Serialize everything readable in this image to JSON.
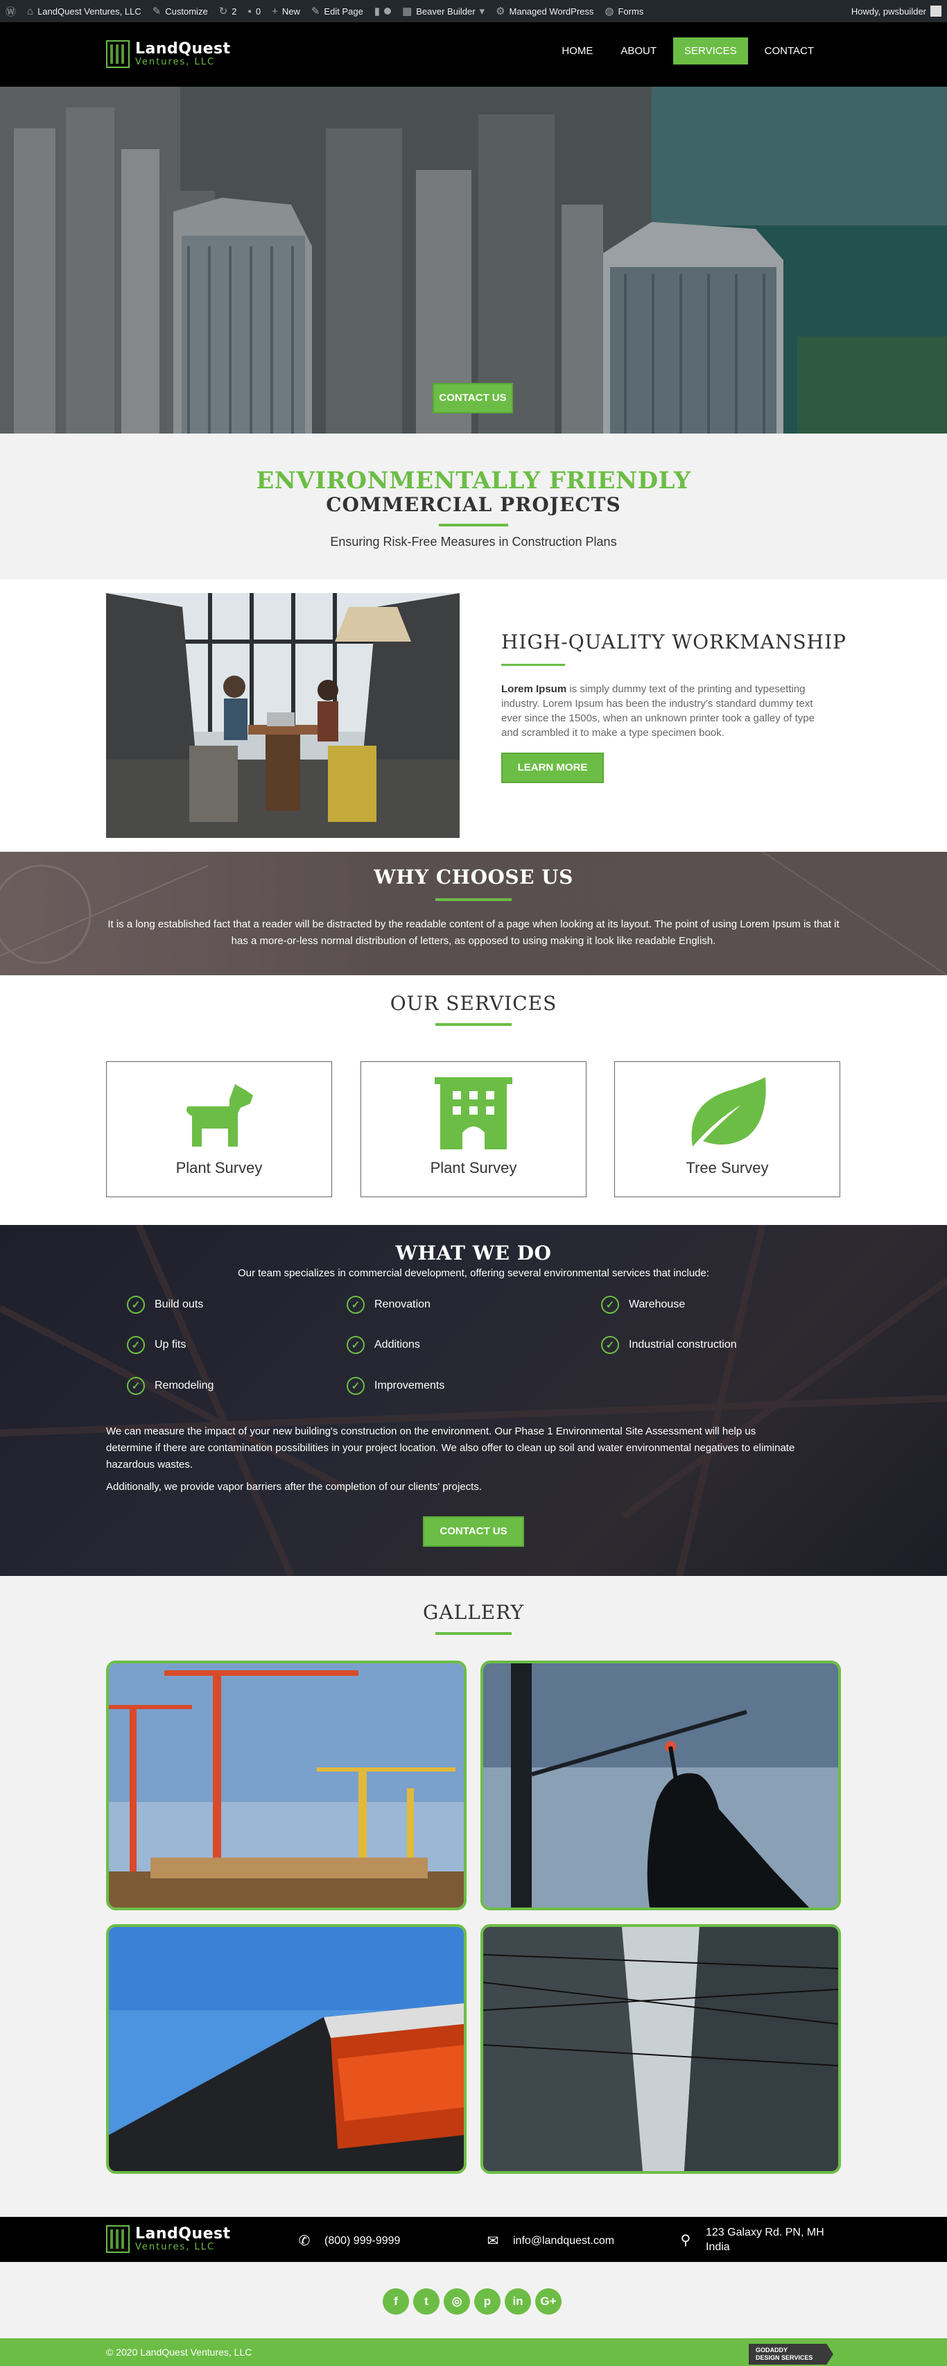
{
  "adminbar": {
    "site_name": "LandQuest Ventures, LLC",
    "customize": "Customize",
    "updates_count": "2",
    "comments_count": "0",
    "new": "New",
    "edit_page": "Edit Page",
    "beaver_builder": "Beaver Builder",
    "managed_wordpress": "Managed WordPress",
    "forms": "Forms",
    "howdy": "Howdy, pwsbuilder"
  },
  "logo": {
    "line1": "LandQuest",
    "line2": "Ventures, LLC"
  },
  "nav": [
    {
      "label": "HOME",
      "active": false
    },
    {
      "label": "ABOUT",
      "active": false
    },
    {
      "label": "SERVICES",
      "active": true
    },
    {
      "label": "CONTACT",
      "active": false
    }
  ],
  "hero": {
    "cta": "CONTACT US"
  },
  "intro": {
    "heading_green": "ENVIRONMENTALLY FRIENDLY",
    "heading_dark": "COMMERCIAL PROJECTS",
    "subheading": "Ensuring Risk-Free Measures in Construction Plans"
  },
  "workmanship": {
    "title": "HIGH-QUALITY WORKMANSHIP",
    "body_bold": "Lorem Ipsum",
    "body": " is simply dummy text of the printing and typesetting industry. Lorem Ipsum has been the industry's standard dummy text ever since the 1500s, when an unknown printer took a galley of type and scrambled it to make a type specimen book.",
    "button": "LEARN MORE"
  },
  "why": {
    "title": "WHY CHOOSE US",
    "body": "It is a long established fact that a reader will be distracted by the readable content of a page when looking at its layout. The point of using Lorem Ipsum is that it has a more-or-less normal distribution of letters, as opposed to using  making it look like readable English."
  },
  "services": {
    "title": "OUR SERVICES",
    "items": [
      {
        "label": "Plant Survey",
        "icon": "dog-icon"
      },
      {
        "label": "Plant Survey",
        "icon": "building-icon"
      },
      {
        "label": "Tree Survey",
        "icon": "leaf-icon"
      }
    ]
  },
  "what": {
    "title": "WHAT WE DO",
    "subtitle": "Our team specializes in commercial development, offering several environmental services that include:",
    "items": [
      "Build outs",
      "Renovation",
      "Warehouse",
      "Up fits",
      "Additions",
      "Industrial construction",
      "Remodeling",
      "Improvements"
    ],
    "para1": "We can measure the impact of your new building's construction on the environment. Our Phase 1 Environmental Site Assessment will help us determine if there are contamination possibilities in your project location. We also offer to clean up soil and water environmental negatives to eliminate hazardous wastes.",
    "para2": "Additionally, we provide vapor barriers after the completion of our clients' projects.",
    "button": "CONTACT US"
  },
  "gallery": {
    "title": "GALLERY"
  },
  "footer": {
    "phone": "(800) 999-9999",
    "email": "info@landquest.com",
    "address_line1": "123 Galaxy Rd. PN, MH",
    "address_line2": "India"
  },
  "social": [
    {
      "name": "facebook-icon",
      "glyph": "f"
    },
    {
      "name": "twitter-icon",
      "glyph": "t"
    },
    {
      "name": "instagram-icon",
      "glyph": "◎"
    },
    {
      "name": "pinterest-icon",
      "glyph": "p"
    },
    {
      "name": "linkedin-icon",
      "glyph": "in"
    },
    {
      "name": "google-plus-icon",
      "glyph": "G+"
    }
  ],
  "copyright": "© 2020 LandQuest Ventures, LLC",
  "badge": {
    "line1": "GODADDY",
    "line2": "DESIGN SERVICES"
  },
  "colors": {
    "accent": "#6cbd45",
    "admin_bar": "#23282d"
  }
}
